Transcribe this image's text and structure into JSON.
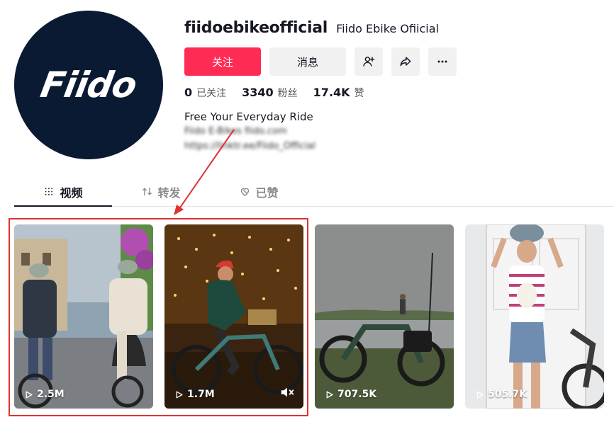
{
  "profile": {
    "avatar_text": "Fiido",
    "username": "fiidoebikeofficial",
    "nickname": "Fiido Ebike Ofiicial",
    "bio": "Free Your Everyday Ride",
    "bio_line2": "Fiido E-Bikes fiido.com",
    "bio_line3": "https://linktr.ee/Fiido_Official"
  },
  "actions": {
    "follow_label": "关注",
    "message_label": "消息",
    "add_friend_icon": "add-person-icon",
    "share_icon": "share-icon",
    "more_icon": "more-icon"
  },
  "stats": {
    "following_count": "0",
    "following_label": "已关注",
    "followers_count": "3340",
    "followers_label": "粉丝",
    "likes_count": "17.4K",
    "likes_label": "赞"
  },
  "tabs": [
    {
      "label": "视频",
      "icon": "grid-icon",
      "active": true
    },
    {
      "label": "转发",
      "icon": "repost-icon",
      "active": false
    },
    {
      "label": "已赞",
      "icon": "liked-heart-icon",
      "active": false
    }
  ],
  "videos": [
    {
      "views": "2.5M"
    },
    {
      "views": "1.7M"
    },
    {
      "views": "707.5K"
    },
    {
      "views": "505.7K"
    }
  ],
  "colors": {
    "accent": "#fe2c55",
    "highlight": "#e03131",
    "avatar_bg": "#0b1a33"
  }
}
